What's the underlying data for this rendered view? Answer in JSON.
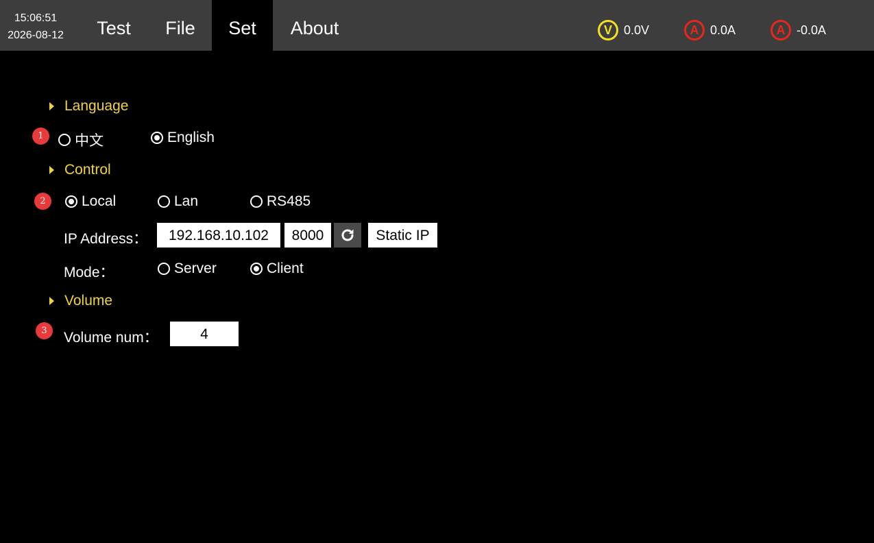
{
  "clock": {
    "time": "15:06:51",
    "date": "2026-08-12"
  },
  "menu": {
    "test": "Test",
    "file": "File",
    "set": "Set",
    "about": "About"
  },
  "meters": {
    "voltage": {
      "symbol": "V",
      "value": "0.0V",
      "color": "#f5e11e"
    },
    "current1": {
      "symbol": "A",
      "value": "0.0A",
      "color": "#e8261c"
    },
    "current2": {
      "symbol": "A",
      "value": "-0.0A",
      "color": "#e8261c"
    }
  },
  "steps": {
    "one": "1",
    "two": "2",
    "three": "3"
  },
  "language": {
    "header": "Language",
    "options": {
      "chinese": "中文",
      "english": "English"
    },
    "selected": "English"
  },
  "control": {
    "header": "Control",
    "options": {
      "local": "Local",
      "lan": "Lan",
      "rs485": "RS485"
    },
    "selected": "Local",
    "ip_label": "IP Address：",
    "ip_value": "192.168.10.102",
    "port_value": "8000",
    "static_ip_label": "Static IP",
    "mode_label": "Mode：",
    "mode_options": {
      "server": "Server",
      "client": "Client"
    },
    "mode_selected": "Client"
  },
  "volume": {
    "header": "Volume",
    "num_label": "Volume num：",
    "num_value": "4"
  },
  "colors": {
    "accent_yellow": "#f2d245",
    "topbar_bg": "#3d3d3d",
    "step_badge": "#e83a3a"
  }
}
